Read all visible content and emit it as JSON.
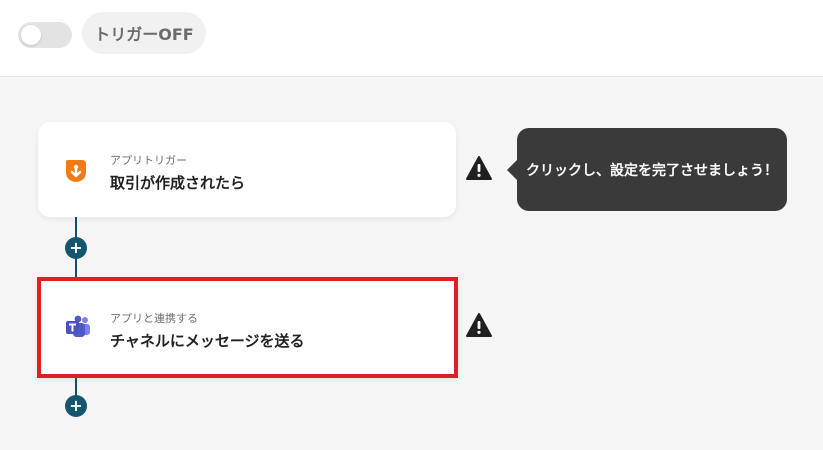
{
  "header": {
    "trigger_toggle_state": "off",
    "trigger_status_label": "トリガーOFF"
  },
  "flow": {
    "steps": [
      {
        "icon": "hubspot-icon",
        "subtitle": "アプリトリガー",
        "title": "取引が作成されたら",
        "status": "warning",
        "selected": false
      },
      {
        "icon": "microsoft-teams-icon",
        "subtitle": "アプリと連携する",
        "title": "チャネルにメッセージを送る",
        "status": "warning",
        "selected": true
      }
    ],
    "add_step_label": "+"
  },
  "tooltip": {
    "text": "クリックし、設定を完了させましょう！"
  },
  "colors": {
    "accent_line": "#174f6a",
    "add_button": "#15566f",
    "selection_border": "#e01e25",
    "tooltip_bg": "#3a3a3a",
    "hubspot_orange": "#f07b18",
    "teams_purple": "#5059c9"
  }
}
